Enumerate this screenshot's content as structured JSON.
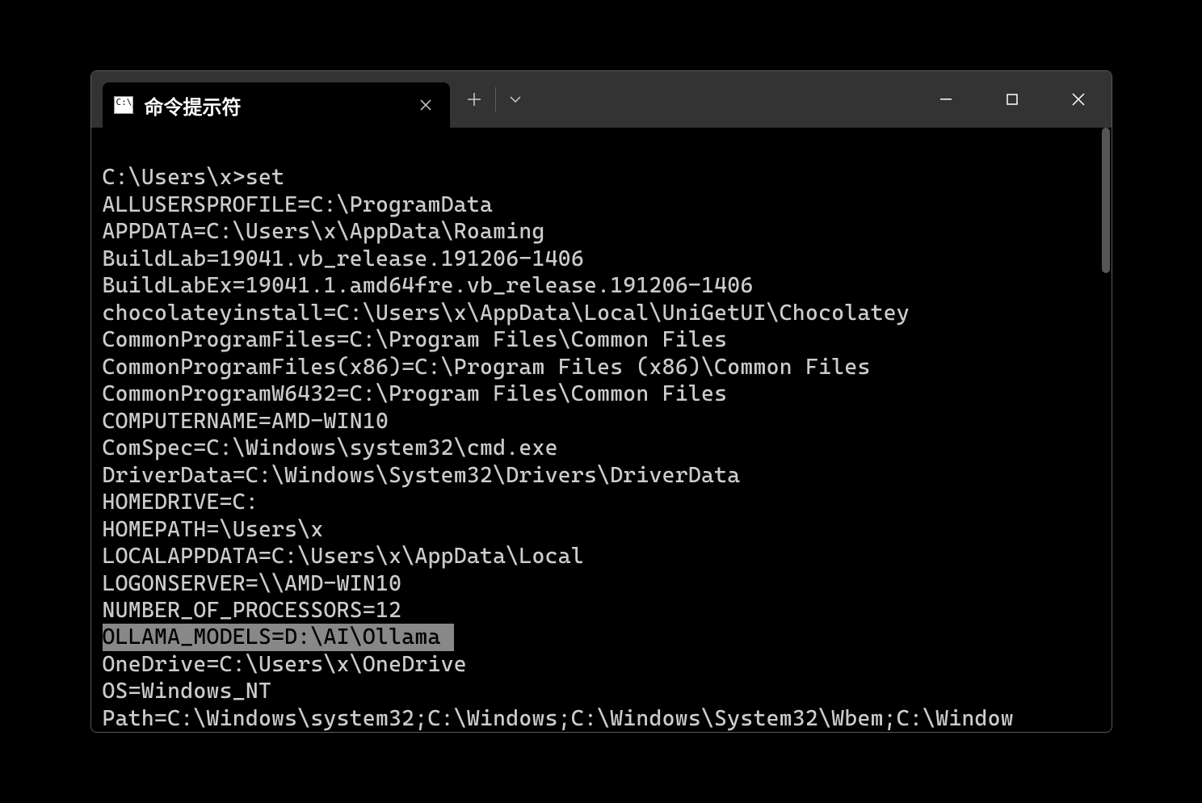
{
  "tab": {
    "title": "命令提示符",
    "icon_label": "C:\\_"
  },
  "terminal": {
    "prompt_line": "C:\\Users\\x>set",
    "lines": [
      "ALLUSERSPROFILE=C:\\ProgramData",
      "APPDATA=C:\\Users\\x\\AppData\\Roaming",
      "BuildLab=19041.vb_release.191206-1406",
      "BuildLabEx=19041.1.amd64fre.vb_release.191206-1406",
      "chocolateyinstall=C:\\Users\\x\\AppData\\Local\\UniGetUI\\Chocolatey",
      "CommonProgramFiles=C:\\Program Files\\Common Files",
      "CommonProgramFiles(x86)=C:\\Program Files (x86)\\Common Files",
      "CommonProgramW6432=C:\\Program Files\\Common Files",
      "COMPUTERNAME=AMD-WIN10",
      "ComSpec=C:\\Windows\\system32\\cmd.exe",
      "DriverData=C:\\Windows\\System32\\Drivers\\DriverData",
      "HOMEDRIVE=C:",
      "HOMEPATH=\\Users\\x",
      "LOCALAPPDATA=C:\\Users\\x\\AppData\\Local",
      "LOGONSERVER=\\\\AMD-WIN10",
      "NUMBER_OF_PROCESSORS=12"
    ],
    "highlighted_line": "OLLAMA_MODELS=D:\\AI\\Ollama",
    "lines_after": [
      "OneDrive=C:\\Users\\x\\OneDrive",
      "OS=Windows_NT",
      "Path=C:\\Windows\\system32;C:\\Windows;C:\\Windows\\System32\\Wbem;C:\\Window"
    ]
  }
}
